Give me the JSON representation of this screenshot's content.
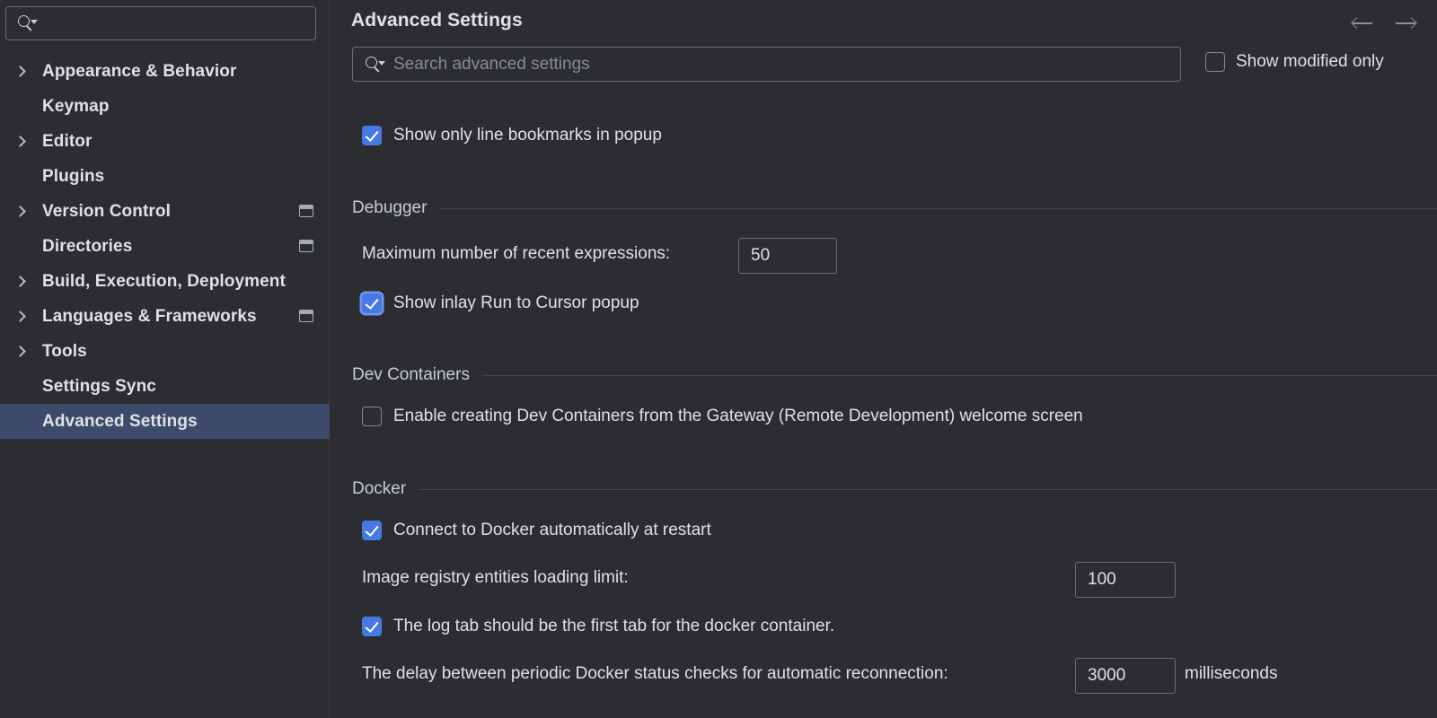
{
  "colors": {
    "background": "#2b2d30",
    "selection": "#3d4a69",
    "accent_checkbox": "#4779e4",
    "focus_ring": "#6c96ee",
    "text": "#dfe1e5",
    "muted_text": "#878c93",
    "border": "#6b6f74"
  },
  "sidebar": {
    "search": {
      "placeholder": "",
      "value": "",
      "icon": "search-icon"
    },
    "items": [
      {
        "label": "Appearance & Behavior",
        "expandable": true,
        "project_icon": false,
        "selected": false
      },
      {
        "label": "Keymap",
        "expandable": false,
        "project_icon": false,
        "selected": false
      },
      {
        "label": "Editor",
        "expandable": true,
        "project_icon": false,
        "selected": false
      },
      {
        "label": "Plugins",
        "expandable": false,
        "project_icon": false,
        "selected": false
      },
      {
        "label": "Version Control",
        "expandable": true,
        "project_icon": true,
        "selected": false
      },
      {
        "label": "Directories",
        "expandable": false,
        "project_icon": true,
        "selected": false
      },
      {
        "label": "Build, Execution, Deployment",
        "expandable": true,
        "project_icon": false,
        "selected": false
      },
      {
        "label": "Languages & Frameworks",
        "expandable": true,
        "project_icon": true,
        "selected": false
      },
      {
        "label": "Tools",
        "expandable": true,
        "project_icon": false,
        "selected": false
      },
      {
        "label": "Settings Sync",
        "expandable": false,
        "project_icon": false,
        "selected": false
      },
      {
        "label": "Advanced Settings",
        "expandable": false,
        "project_icon": false,
        "selected": true
      }
    ]
  },
  "header": {
    "title": "Advanced Settings",
    "back_arrow": "arrow-left-icon",
    "forward_arrow": "arrow-right-icon"
  },
  "search": {
    "placeholder": "Search advanced settings",
    "value": "",
    "icon": "search-icon"
  },
  "show_modified": {
    "label": "Show modified only",
    "checked": false
  },
  "settings": {
    "bookmark_popup": {
      "label": "Show only line bookmarks in popup",
      "checked": true
    },
    "debugger": {
      "section_title": "Debugger",
      "max_recent_expressions_label": "Maximum number of recent expressions:",
      "max_recent_expressions_value": "50",
      "inlay_run_to_cursor_label": "Show inlay Run to Cursor popup",
      "inlay_run_to_cursor_checked": true,
      "inlay_run_to_cursor_focused": true
    },
    "dev_containers": {
      "section_title": "Dev Containers",
      "enable_label": "Enable creating Dev Containers from the Gateway (Remote Development) welcome screen",
      "enable_checked": false
    },
    "docker": {
      "section_title": "Docker",
      "connect_label": "Connect to Docker automatically at restart",
      "connect_checked": true,
      "registry_limit_label": "Image registry entities loading limit:",
      "registry_limit_value": "100",
      "log_tab_label": "The log tab should be the first tab for the docker container.",
      "log_tab_checked": true,
      "delay_label": "The delay between periodic Docker status checks for automatic reconnection:",
      "delay_value": "3000",
      "delay_unit": "milliseconds"
    }
  }
}
